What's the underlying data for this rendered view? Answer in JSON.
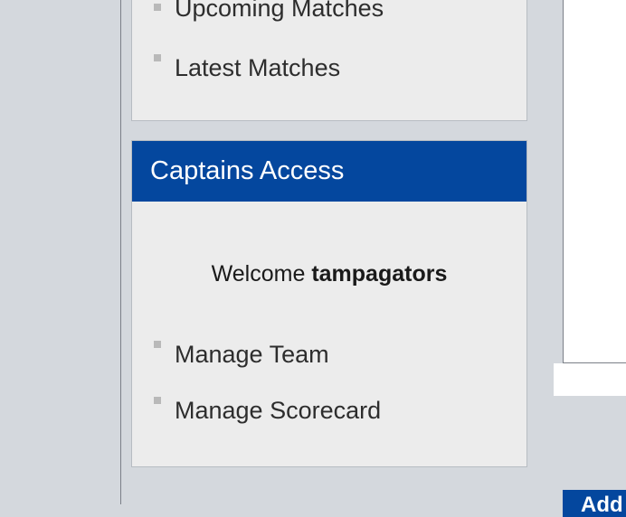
{
  "sidebar": {
    "menu": {
      "items": [
        {
          "label": "Upcoming Matches"
        },
        {
          "label": "Latest Matches"
        }
      ]
    },
    "captains": {
      "title": "Captains Access",
      "welcome_prefix": "Welcome",
      "username": "tampagators",
      "items": [
        {
          "label": "Manage Team"
        },
        {
          "label": "Manage Scorecard"
        }
      ]
    }
  },
  "content": {
    "add_button_label": "Add"
  },
  "colors": {
    "header_bg": "#04479e",
    "panel_bg": "#ececec",
    "page_bg": "#d4d8dd"
  }
}
